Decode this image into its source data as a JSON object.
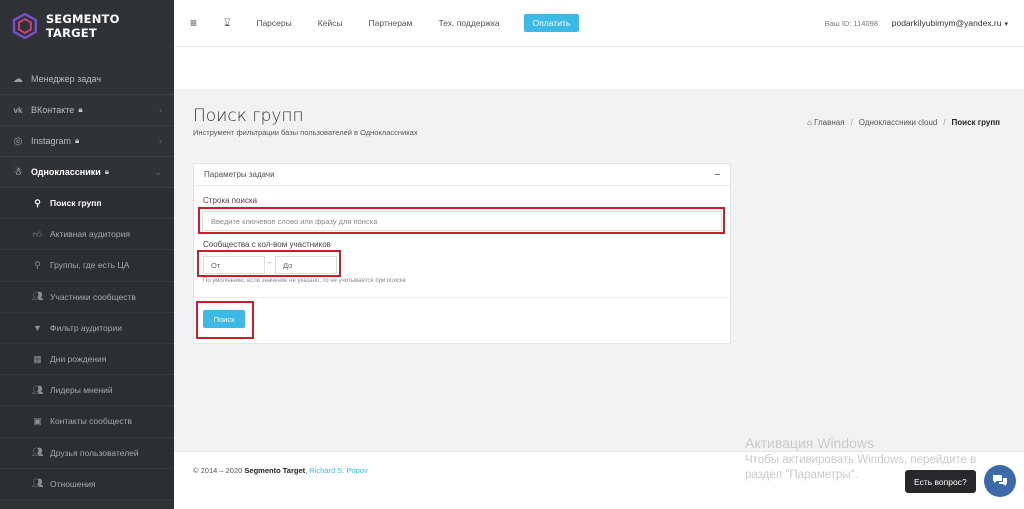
{
  "brand": {
    "name": "SEGMENTO TARGET"
  },
  "sidebar": {
    "items": [
      {
        "label": "Менеджер задач",
        "icon": "cloud-icon",
        "lock": false,
        "chevron": false
      },
      {
        "label": "ВКонтакте",
        "icon": "vk-icon",
        "lock": true,
        "chevron": true
      },
      {
        "label": "Instagram",
        "icon": "instagram-icon",
        "lock": true,
        "chevron": true
      },
      {
        "label": "Одноклассники",
        "icon": "ok-icon",
        "lock": true,
        "chevron": true
      }
    ],
    "subitems": [
      {
        "label": "Поиск групп",
        "icon": "search-icon",
        "active": true
      },
      {
        "label": "Активная аудитория",
        "icon": "thumbs-up-icon",
        "active": false
      },
      {
        "label": "Группы, где есть ЦА",
        "icon": "search-icon",
        "active": false
      },
      {
        "label": "Участники сообществ",
        "icon": "users-icon",
        "active": false
      },
      {
        "label": "Фильтр аудитории",
        "icon": "filter-icon",
        "active": false
      },
      {
        "label": "Дни рождения",
        "icon": "calendar-icon",
        "active": false
      },
      {
        "label": "Лидеры мнений",
        "icon": "users-icon",
        "active": false
      },
      {
        "label": "Контакты сообществ",
        "icon": "contact-card-icon",
        "active": false
      },
      {
        "label": "Друзья пользователей",
        "icon": "users-icon",
        "active": false
      },
      {
        "label": "Отношения",
        "icon": "users-icon",
        "active": false
      }
    ]
  },
  "topbar": {
    "menu": [
      "Парсеры",
      "Кейсы",
      "Партнерам",
      "Тех. поддержка"
    ],
    "pay_label": "Оплатить",
    "user_id": "Ваш ID: 114098",
    "user_email": "podarkilyubimym@yandex.ru"
  },
  "page": {
    "title": "Поиск групп",
    "subtitle": "Инструмент фильтрации базы пользователей в Одноклассниках"
  },
  "breadcrumb": {
    "home": "Главная",
    "section": "Одноклассники cloud",
    "current": "Поиск групп"
  },
  "form": {
    "panel_title": "Параметры задачи",
    "search_label": "Строка поиска",
    "search_placeholder": "Введите ключевое слово или фразу для поиска",
    "members_label": "Сообщества с кол-вом участников",
    "from_placeholder": "От",
    "to_placeholder": "До",
    "range_separator": "-",
    "hint": "По умолчанию, если значение не указано, то не учитывается при поиске",
    "submit_label": "Поиск"
  },
  "footer": {
    "copyright": "© 2014 – 2020",
    "brand": "Segmento Target",
    "author": "Richard S. Popov"
  },
  "watermark": {
    "title": "Активация Windows",
    "text": "Чтобы активировать Windows, перейдите в раздел \"Параметры\"."
  },
  "chat": {
    "label": "Есть вопрос?"
  },
  "colors": {
    "accent": "#3db9e6",
    "sidebar": "#2f3237",
    "highlight": "#c8202a"
  }
}
